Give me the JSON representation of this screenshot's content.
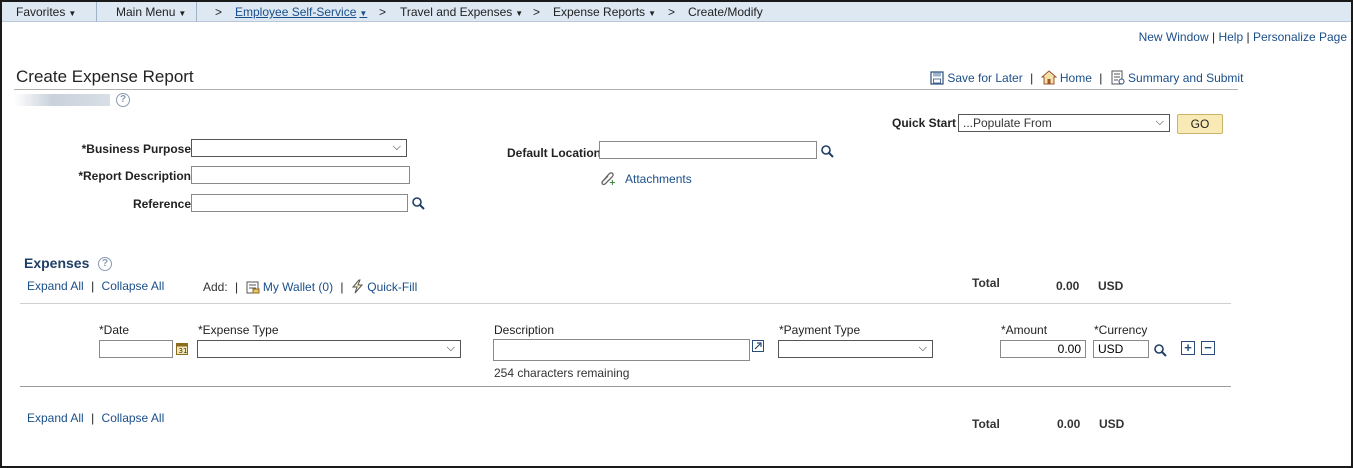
{
  "nav": {
    "favorites": "Favorites",
    "main_menu": "Main Menu",
    "sep": ">",
    "employee_self_service": "Employee Self-Service",
    "travel_and_expenses": "Travel and Expenses",
    "expense_reports": "Expense Reports",
    "create_modify": "Create/Modify"
  },
  "toplinks": {
    "new_window": "New Window",
    "help": "Help",
    "personalize_page": "Personalize Page",
    "pipe": "|"
  },
  "page": {
    "title": "Create Expense Report",
    "help_glyph": "?",
    "actions": {
      "save_for_later": "Save for Later",
      "home": "Home",
      "summary_and_submit": "Summary and Submit"
    }
  },
  "quick_start": {
    "label": "Quick Start",
    "selected": "...Populate From",
    "go": "GO"
  },
  "form": {
    "business_purpose_label": "*Business Purpose",
    "business_purpose_value": "",
    "report_description_label": "*Report Description",
    "report_description_value": "",
    "reference_label": "Reference",
    "reference_value": "",
    "default_location_label": "Default Location",
    "default_location_value": "",
    "attachments": "Attachments"
  },
  "expenses": {
    "title": "Expenses",
    "expand_all": "Expand All",
    "collapse_all": "Collapse All",
    "add_label": "Add:",
    "my_wallet": "My Wallet (0)",
    "quick_fill": "Quick-Fill",
    "total_label": "Total",
    "total_value": "0.00",
    "total_currency": "USD",
    "columns": {
      "date": "*Date",
      "expense_type": "*Expense Type",
      "description": "Description",
      "payment_type": "*Payment Type",
      "amount": "*Amount",
      "currency": "*Currency"
    },
    "row": {
      "date": "",
      "expense_type": "",
      "description": "",
      "chars_remaining": "254 characters remaining",
      "payment_type": "",
      "amount": "0.00",
      "currency": "USD"
    },
    "add_row": "+",
    "delete_row": "−"
  },
  "icons": {
    "save": "save-icon",
    "home": "home-icon",
    "summary": "summary-icon",
    "search": "magnifier-icon",
    "attachment": "paperclip-add-icon",
    "wallet": "wallet-icon",
    "quickfill": "lightning-icon",
    "calendar": "calendar-icon",
    "expand_text": "expand-text-icon"
  },
  "colors": {
    "nav_bg": "#dde8f3",
    "link": "#1b4f8a",
    "section_title": "#1f3f66",
    "go_button": "#f9eab5"
  }
}
